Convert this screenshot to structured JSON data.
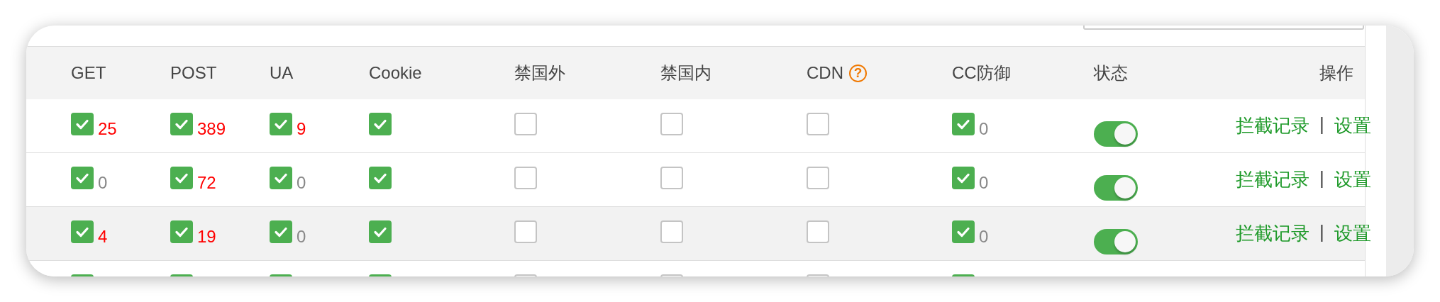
{
  "columns": [
    {
      "label": "GET"
    },
    {
      "label": "POST"
    },
    {
      "label": "UA"
    },
    {
      "label": "Cookie"
    },
    {
      "label": "禁国外"
    },
    {
      "label": "禁国内"
    },
    {
      "label": "CDN",
      "help": "?"
    },
    {
      "label": "CC防御"
    },
    {
      "label": "状态"
    },
    {
      "label": "操作"
    }
  ],
  "rows": [
    {
      "highlighted": false,
      "rules": [
        {
          "checked": true,
          "count": "25",
          "alert": true
        },
        {
          "checked": true,
          "count": "389",
          "alert": true
        },
        {
          "checked": true,
          "count": "9",
          "alert": true
        },
        {
          "checked": true
        },
        {
          "checked": false
        },
        {
          "checked": false
        },
        {
          "checked": false
        },
        {
          "checked": true,
          "count": "0",
          "alert": false
        }
      ],
      "status": {
        "on": true
      },
      "actions": [
        {
          "label": "拦截记录"
        },
        {
          "label": "设置"
        }
      ],
      "separator": "|"
    },
    {
      "highlighted": false,
      "rules": [
        {
          "checked": true,
          "count": "0",
          "alert": false
        },
        {
          "checked": true,
          "count": "72",
          "alert": true
        },
        {
          "checked": true,
          "count": "0",
          "alert": false
        },
        {
          "checked": true
        },
        {
          "checked": false
        },
        {
          "checked": false
        },
        {
          "checked": false
        },
        {
          "checked": true,
          "count": "0",
          "alert": false
        }
      ],
      "status": {
        "on": true
      },
      "actions": [
        {
          "label": "拦截记录"
        },
        {
          "label": "设置"
        }
      ],
      "separator": "|"
    },
    {
      "highlighted": true,
      "rules": [
        {
          "checked": true,
          "count": "4",
          "alert": true
        },
        {
          "checked": true,
          "count": "19",
          "alert": true
        },
        {
          "checked": true,
          "count": "0",
          "alert": false
        },
        {
          "checked": true
        },
        {
          "checked": false
        },
        {
          "checked": false
        },
        {
          "checked": false
        },
        {
          "checked": true,
          "count": "0",
          "alert": false
        }
      ],
      "status": {
        "on": true
      },
      "actions": [
        {
          "label": "拦截记录"
        },
        {
          "label": "设置"
        }
      ],
      "separator": "|"
    },
    {
      "highlighted": false,
      "rules": [
        {
          "checked": true
        },
        {
          "checked": true
        },
        {
          "checked": true
        },
        {
          "checked": true
        },
        {
          "checked": false
        },
        {
          "checked": false
        },
        {
          "checked": false
        },
        {
          "checked": true
        }
      ]
    }
  ]
}
